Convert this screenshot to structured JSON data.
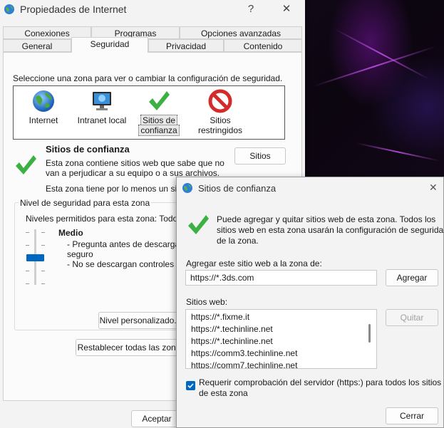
{
  "main": {
    "title": "Propiedades de Internet",
    "help": "?",
    "close": "✕",
    "tabs_top": [
      "Conexiones",
      "Programas",
      "Opciones avanzadas"
    ],
    "tabs_bottom": [
      "General",
      "Seguridad",
      "Privacidad",
      "Contenido"
    ],
    "active_tab": "Seguridad",
    "zone_prompt": "Seleccione una zona para ver o cambiar la configuración de seguridad.",
    "zones": [
      {
        "label1": "Internet",
        "label2": "",
        "icon": "globe-icon"
      },
      {
        "label1": "Intranet local",
        "label2": "",
        "icon": "intranet-icon"
      },
      {
        "label1": "Sitios de",
        "label2": "confianza",
        "icon": "checkmark-icon"
      },
      {
        "label1": "Sitios",
        "label2": "restringidos",
        "icon": "prohibited-icon"
      }
    ],
    "zone_title": "Sitios de confianza",
    "zone_desc1": "Esta zona contiene sitios web que sabe que no",
    "zone_desc2": "van a perjudicar a su equipo o a sus archivos.",
    "zone_desc3": "Esta zona tiene por lo menos un sitio",
    "sites_button": "Sitios",
    "level_group": "Nivel de seguridad para esta zona",
    "levels_allowed": "Niveles permitidos para esta zona: Todos",
    "level_name": "Medio",
    "level_bullets": [
      "- Pregunta antes de descargar",
      "seguro",
      "- No se descargan controles Ac"
    ],
    "custom_level_button": "Nivel personalizado...",
    "reset_button": "Restablecer todas las zona",
    "accept_button": "Aceptar"
  },
  "trusted": {
    "title": "Sitios de confianza",
    "close": "✕",
    "info1": "Puede agregar y quitar sitios web de esta zona. Todos los",
    "info2": "sitios web en esta zona usarán la configuración de seguridad",
    "info3": "de la zona.",
    "add_label": "Agregar este sitio web a la zona de:",
    "add_value": "https://*.3ds.com",
    "add_button": "Agregar",
    "sites_label": "Sitios web:",
    "sites": [
      "https://*.fixme.it",
      "https://*.techinline.net",
      "https://*.techinline.net",
      "https://comm3.techinline.net",
      "https://comm7.techinline.net"
    ],
    "remove_button": "Quitar",
    "https_check_line1": "Requerir comprobación del servidor (https:) para todos los sitios",
    "https_check_line2": "de esta zona",
    "https_checked": true,
    "close_button": "Cerrar"
  },
  "colors": {
    "accent": "#0067c0",
    "check_green": "#3cb043",
    "prohibited_red": "#d42a2a"
  }
}
